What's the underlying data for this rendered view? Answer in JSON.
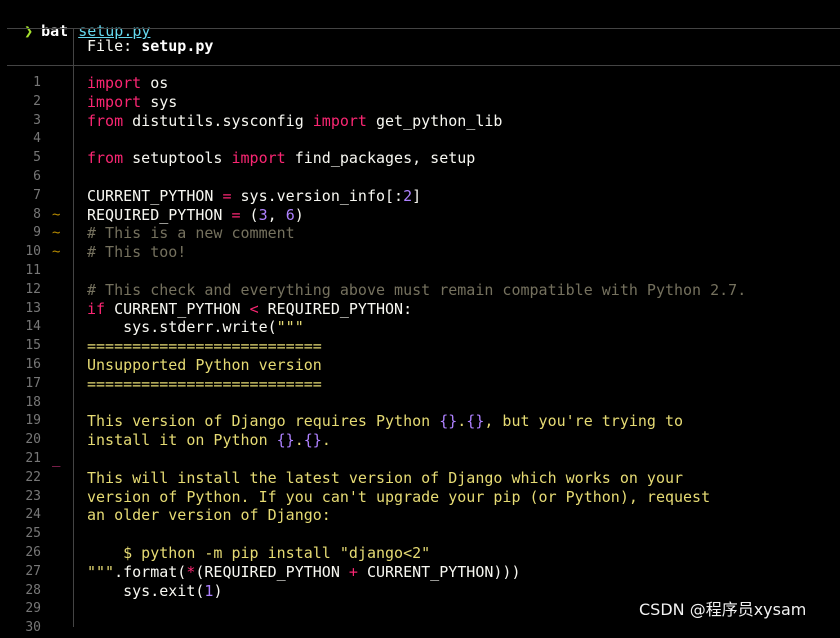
{
  "prompt": {
    "symbol": "❯",
    "command": "bat",
    "argument": "setup.py"
  },
  "header": {
    "label": "File: ",
    "filename": "setup.py"
  },
  "colors": {
    "keyword": "#f92672",
    "number": "#ae81ff",
    "string": "#e6db74",
    "comment": "#75715e",
    "text": "#f8f8f2",
    "added": "#d33682",
    "modified": "#b58900"
  },
  "lines": [
    {
      "n": "1",
      "m": "",
      "t": [
        [
          "kw",
          "import"
        ],
        [
          "txt",
          " os"
        ]
      ]
    },
    {
      "n": "2",
      "m": "",
      "t": [
        [
          "kw",
          "import"
        ],
        [
          "txt",
          " sys"
        ]
      ]
    },
    {
      "n": "3",
      "m": "",
      "t": [
        [
          "kw",
          "from"
        ],
        [
          "txt",
          " distutils.sysconfig "
        ],
        [
          "kw",
          "import"
        ],
        [
          "txt",
          " get_python_lib"
        ]
      ]
    },
    {
      "n": "4",
      "m": "",
      "t": []
    },
    {
      "n": "5",
      "m": "",
      "t": [
        [
          "kw",
          "from"
        ],
        [
          "txt",
          " setuptools "
        ],
        [
          "kw",
          "import"
        ],
        [
          "txt",
          " find_packages, setup"
        ]
      ]
    },
    {
      "n": "6",
      "m": "",
      "t": []
    },
    {
      "n": "7",
      "m": "",
      "t": [
        [
          "txt",
          "CURRENT_PYTHON "
        ],
        [
          "kw",
          "="
        ],
        [
          "txt",
          " sys.version_info[:"
        ],
        [
          "num",
          "2"
        ],
        [
          "txt",
          "]"
        ]
      ]
    },
    {
      "n": "8",
      "m": "~",
      "t": [
        [
          "txt",
          "REQUIRED_PYTHON "
        ],
        [
          "kw",
          "="
        ],
        [
          "txt",
          " ("
        ],
        [
          "num",
          "3"
        ],
        [
          "txt",
          ", "
        ],
        [
          "num",
          "6"
        ],
        [
          "txt",
          ")"
        ]
      ]
    },
    {
      "n": "9",
      "m": "~",
      "t": [
        [
          "cm",
          "# This is a new comment"
        ]
      ]
    },
    {
      "n": "10",
      "m": "~",
      "t": [
        [
          "cm",
          "# This too!"
        ]
      ]
    },
    {
      "n": "11",
      "m": "",
      "t": []
    },
    {
      "n": "12",
      "m": "",
      "t": [
        [
          "cm",
          "# This check and everything above must remain compatible with Python 2.7."
        ]
      ]
    },
    {
      "n": "13",
      "m": "",
      "t": [
        [
          "kw",
          "if"
        ],
        [
          "txt",
          " CURRENT_PYTHON "
        ],
        [
          "kw",
          "<"
        ],
        [
          "txt",
          " REQUIRED_PYTHON:"
        ]
      ]
    },
    {
      "n": "14",
      "m": "",
      "t": [
        [
          "txt",
          "    sys.stderr.write("
        ],
        [
          "str",
          "\"\"\""
        ]
      ]
    },
    {
      "n": "15",
      "m": "",
      "t": [
        [
          "str",
          "=========================="
        ]
      ]
    },
    {
      "n": "16",
      "m": "",
      "t": [
        [
          "str",
          "Unsupported Python version"
        ]
      ]
    },
    {
      "n": "17",
      "m": "",
      "t": [
        [
          "str",
          "=========================="
        ]
      ]
    },
    {
      "n": "18",
      "m": "",
      "t": []
    },
    {
      "n": "19",
      "m": "",
      "t": [
        [
          "str",
          "This version of Django requires Python "
        ],
        [
          "num",
          "{}"
        ],
        [
          "str",
          "."
        ],
        [
          "num",
          "{}"
        ],
        [
          "str",
          ", but you're trying to"
        ]
      ]
    },
    {
      "n": "20",
      "m": "",
      "t": [
        [
          "str",
          "install it on Python "
        ],
        [
          "num",
          "{}"
        ],
        [
          "str",
          "."
        ],
        [
          "num",
          "{}"
        ],
        [
          "str",
          "."
        ]
      ]
    },
    {
      "n": "21",
      "m": "_",
      "t": []
    },
    {
      "n": "22",
      "m": "",
      "t": [
        [
          "str",
          "This will install the latest version of Django which works on your"
        ]
      ]
    },
    {
      "n": "23",
      "m": "",
      "t": [
        [
          "str",
          "version of Python. If you can't upgrade your pip (or Python), request"
        ]
      ]
    },
    {
      "n": "24",
      "m": "",
      "t": [
        [
          "str",
          "an older version of Django:"
        ]
      ]
    },
    {
      "n": "25",
      "m": "",
      "t": []
    },
    {
      "n": "26",
      "m": "",
      "t": [
        [
          "str",
          "    $ python -m pip install \"django<2\""
        ]
      ]
    },
    {
      "n": "27",
      "m": "",
      "t": [
        [
          "str",
          "\"\"\""
        ],
        [
          "txt",
          ".format("
        ],
        [
          "kw",
          "*"
        ],
        [
          "txt",
          "(REQUIRED_PYTHON "
        ],
        [
          "kw",
          "+"
        ],
        [
          "txt",
          " CURRENT_PYTHON)))"
        ]
      ]
    },
    {
      "n": "28",
      "m": "",
      "t": [
        [
          "txt",
          "    sys.exit("
        ],
        [
          "num",
          "1"
        ],
        [
          "txt",
          ")"
        ]
      ]
    },
    {
      "n": "29",
      "m": "",
      "t": []
    },
    {
      "n": "30",
      "m": "",
      "t": []
    }
  ],
  "watermark": "CSDN @程序员xysam"
}
